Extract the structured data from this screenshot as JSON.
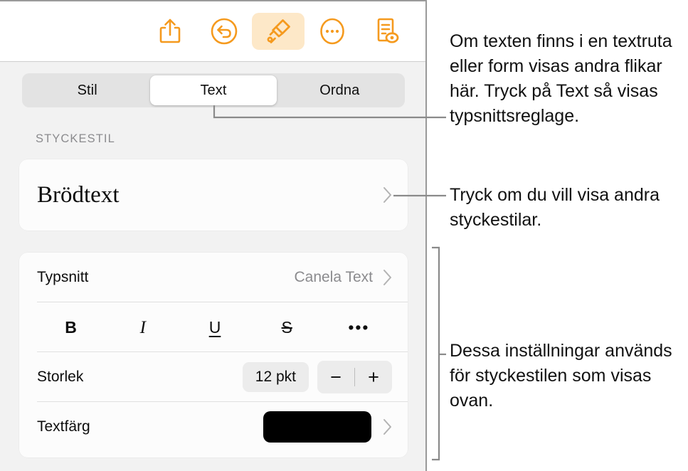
{
  "toolbar": {
    "buttons": [
      {
        "name": "share-icon",
        "label": "Dela"
      },
      {
        "name": "undo-icon",
        "label": "Ångra"
      },
      {
        "name": "paintbrush-icon",
        "label": "Format",
        "selected": true
      },
      {
        "name": "more-icon",
        "label": "Mer"
      },
      {
        "name": "document-eye-icon",
        "label": "Dokumentgranskning"
      }
    ],
    "accent_color": "#f59a1e",
    "accent_background": "#fde8c8"
  },
  "segmented_control": {
    "selected": "Text",
    "tabs": [
      {
        "label": "Stil",
        "selected": false
      },
      {
        "label": "Text",
        "selected": true
      },
      {
        "label": "Ordna",
        "selected": false
      }
    ]
  },
  "paragraph_style_section": {
    "header": "STYCKESTIL",
    "value": "Brödtext",
    "chevron": "chevron-right-icon"
  },
  "font_section": {
    "font_row": {
      "label": "Typsnitt",
      "value": "Canela Text",
      "chevron": "chevron-right-icon"
    },
    "format_buttons": [
      {
        "name": "bold-button",
        "label": "B"
      },
      {
        "name": "italic-button",
        "label": "I"
      },
      {
        "name": "underline-button",
        "label": "U"
      },
      {
        "name": "strikethrough-button",
        "label": "S"
      },
      {
        "name": "more-format-button",
        "label": "•••"
      }
    ],
    "size_row": {
      "label": "Storlek",
      "value": "12 pkt",
      "decrease": "−",
      "increase": "+"
    },
    "color_row": {
      "label": "Textfärg",
      "swatch_color": "#000000",
      "chevron": "chevron-right-icon"
    }
  },
  "annotations": [
    {
      "id": "annot-1",
      "text": "Om texten finns i en textruta eller form visas andra flikar här. Tryck på Text så visas typsnittsreglage."
    },
    {
      "id": "annot-2",
      "text": "Tryck om du vill visa andra styckestilar."
    },
    {
      "id": "annot-3",
      "text": "Dessa inställningar används för styckestilen som visas ovan."
    }
  ],
  "connector_color": "#8a8a8a"
}
